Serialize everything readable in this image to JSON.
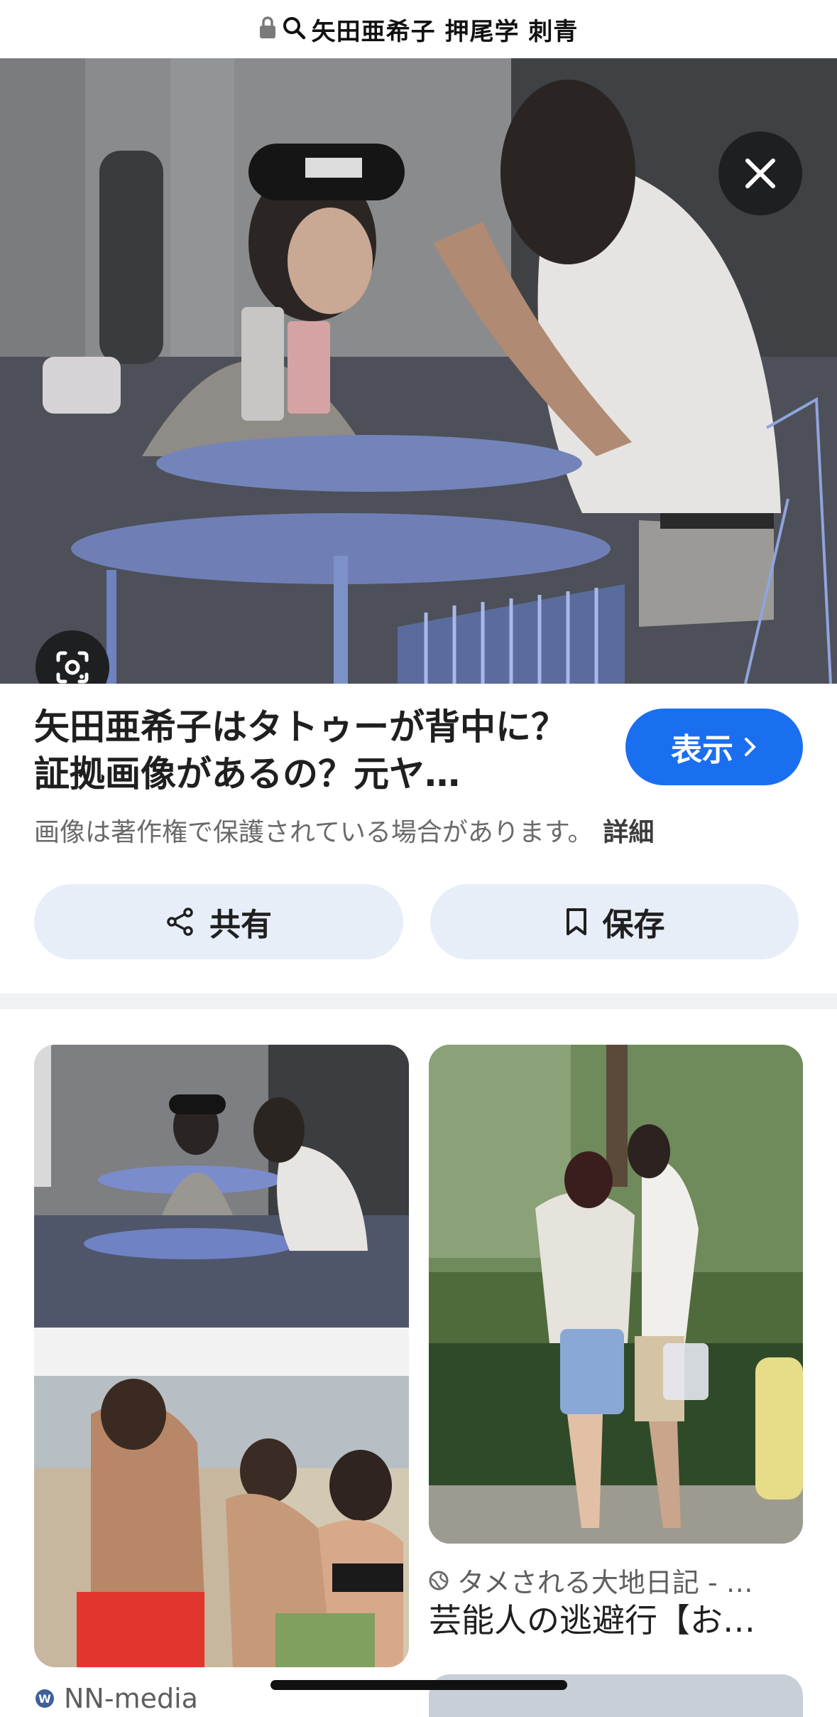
{
  "search": {
    "query": "矢田亜希子 押尾学 刺青"
  },
  "detail": {
    "title": "矢田亜希子はタトゥーが背中に？証拠画像があるの？元ヤ…",
    "view_label": "表示",
    "copyright": "画像は著作権で保護されている場合があります。",
    "details_label": "詳細",
    "share_label": "共有",
    "save_label": "保存"
  },
  "related": [
    {
      "source": "NN-media",
      "title": ""
    },
    {
      "source": "タメされる大地日記 - …",
      "title": "芸能人の逃避行【お…"
    }
  ],
  "colors": {
    "accent": "#1a6ff0",
    "chip_bg": "#e8eef8",
    "divider": "#f0f2f5"
  }
}
